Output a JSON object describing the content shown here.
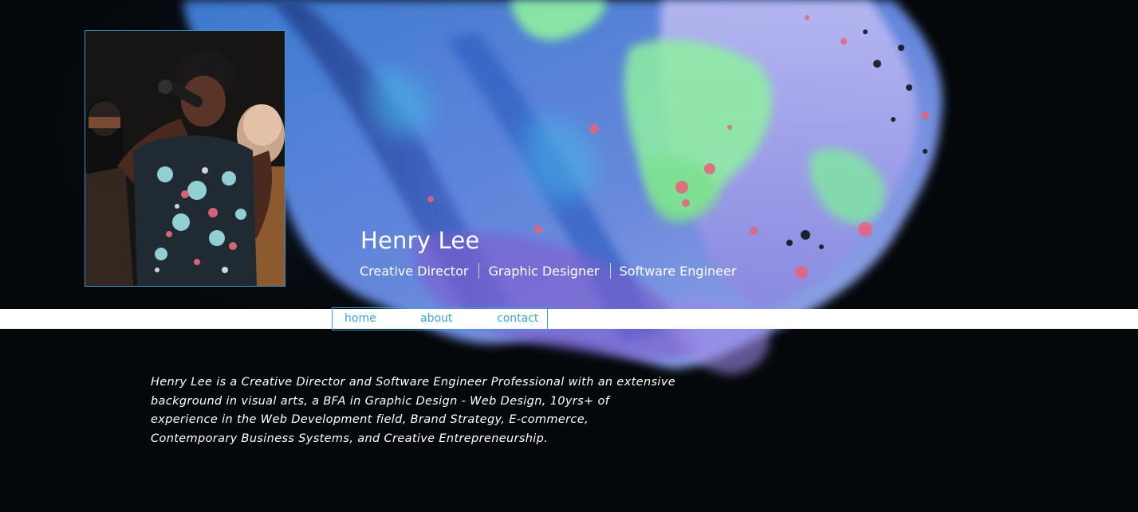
{
  "profile": {
    "name": "Henry Lee",
    "roles": [
      "Creative Director",
      "Graphic Designer",
      "Software Engineer"
    ]
  },
  "nav": {
    "items": [
      {
        "label": "home"
      },
      {
        "label": "about"
      },
      {
        "label": "contact"
      }
    ]
  },
  "bio": {
    "text": "Henry Lee is a Creative Director and Software Engineer Professional with an extensive background in visual arts, a BFA in Graphic Design - Web Design, 10yrs+ of experience in the Web Development field, Brand Strategy, E-commerce, Contemporary Business Systems, and Creative Entrepreneurship."
  },
  "colors": {
    "background": "#05080b",
    "accent": "#3aa5d8",
    "text": "#ffffff",
    "paint_blue": "#5f7fe0",
    "paint_green": "#8ef0a0",
    "paint_lavender": "#b9b3f2"
  }
}
